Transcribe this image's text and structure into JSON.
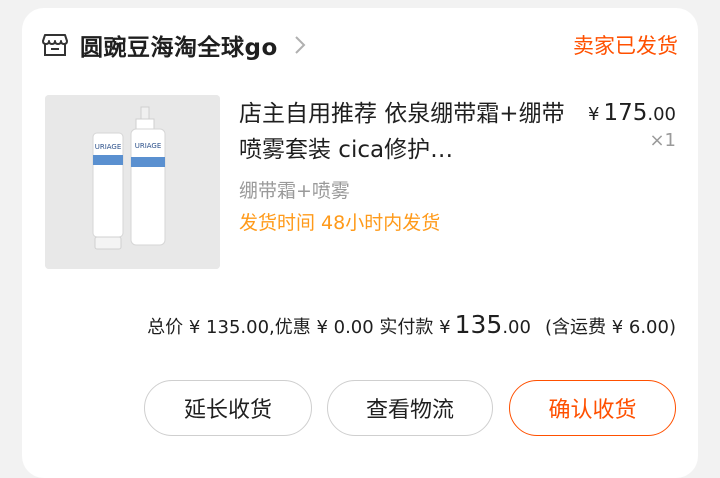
{
  "shop": {
    "name": "圆豌豆海淘全球go",
    "status": "卖家已发货"
  },
  "product": {
    "title": "店主自用推荐 依泉绷带霜+绷带喷雾套装 cica修护…",
    "price_currency": "¥",
    "price_int": "175",
    "price_dec": ".00",
    "quantity": "×1",
    "variant": "绷带霜+喷雾",
    "ship_time": "发货时间 48小时内发货",
    "image_brand": "URIAGE"
  },
  "totals": {
    "prefix": "总价 ¥ 135.00,优惠 ¥ 0.00 实付款 ¥",
    "paid_int": "135",
    "paid_dec": ".00",
    "shipping": "(含运费 ¥ 6.00)"
  },
  "actions": {
    "extend": "延长收货",
    "logistics": "查看物流",
    "confirm": "确认收货"
  },
  "colors": {
    "accent": "#ff5000",
    "ship_time": "#ff9a1a"
  }
}
